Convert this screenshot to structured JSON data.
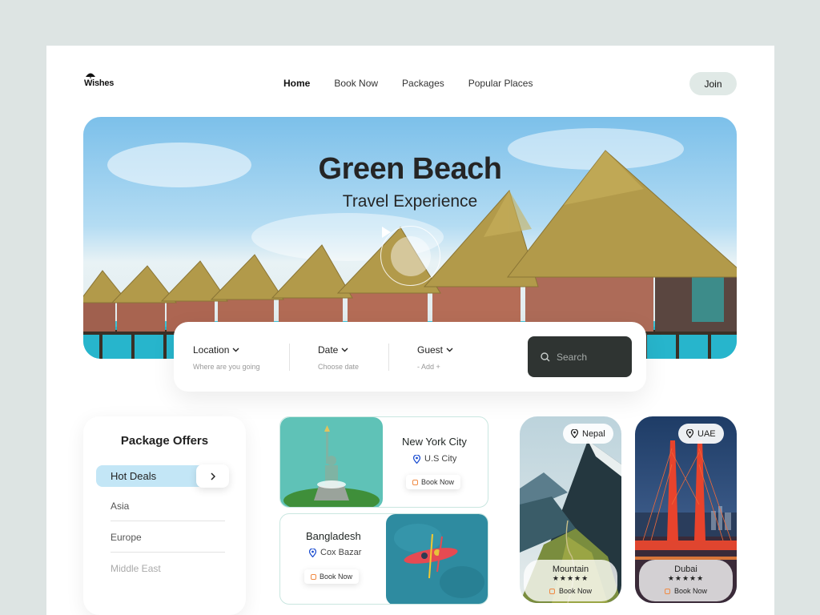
{
  "header": {
    "logo_text": "Wishes",
    "nav": [
      "Home",
      "Book Now",
      "Packages",
      "Popular Places"
    ],
    "join_label": "Join"
  },
  "hero": {
    "title": "Green Beach",
    "subtitle": "Travel Experience",
    "play_icon": "play-icon"
  },
  "search": {
    "fields": [
      {
        "label": "Location",
        "hint": "Where are you going"
      },
      {
        "label": "Date",
        "hint": "Choose date"
      },
      {
        "label": "Guest",
        "hint": "- Add +"
      }
    ],
    "button_placeholder": "Search"
  },
  "offers": {
    "title": "Package Offers",
    "active": "Hot Deals",
    "items": [
      "Asia",
      "Europe",
      "Middle East"
    ]
  },
  "cards": {
    "nyc": {
      "name": "New York City",
      "location": "U.S City",
      "book": "Book Now"
    },
    "bangladesh": {
      "name": "Bangladesh",
      "location": "Cox Bazar",
      "book": "Book Now"
    },
    "nepal": {
      "badge": "Nepal",
      "name": "Mountain",
      "stars": "★★★★★",
      "book": "Book Now"
    },
    "uae": {
      "badge": "UAE",
      "name": "Dubai",
      "stars": "★★★★★",
      "book": "Book Now"
    }
  },
  "colors": {
    "accent_dark": "#2f3432",
    "active_bg": "#c3e6f6",
    "join_bg": "#e0e9e6",
    "tag_orange": "#f08a43",
    "pin_blue": "#1d4fd1"
  }
}
